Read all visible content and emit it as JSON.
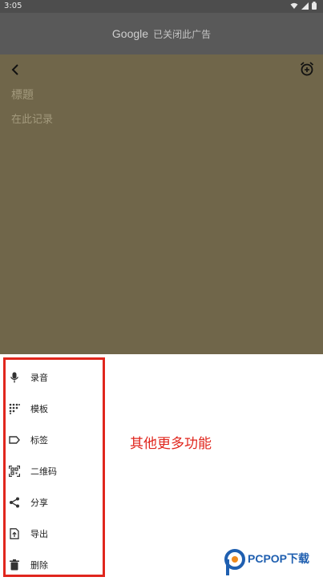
{
  "status_bar": {
    "time": "3:05",
    "icons": [
      "wifi-icon",
      "signal-icon",
      "battery-icon"
    ]
  },
  "ad_banner": {
    "brand": "Google",
    "text": "已关闭此广告"
  },
  "note": {
    "title_placeholder": "標題",
    "body_placeholder": "在此记录"
  },
  "menu": {
    "items": [
      {
        "label": "录音",
        "icon": "microphone-icon"
      },
      {
        "label": "模板",
        "icon": "template-icon"
      },
      {
        "label": "标签",
        "icon": "label-icon"
      },
      {
        "label": "二维码",
        "icon": "qr-code-icon"
      },
      {
        "label": "分享",
        "icon": "share-icon"
      },
      {
        "label": "导出",
        "icon": "export-icon"
      },
      {
        "label": "删除",
        "icon": "delete-icon"
      }
    ]
  },
  "annotation": {
    "text": "其他更多功能"
  },
  "watermark": {
    "brand": "PCPOP下载"
  },
  "colors": {
    "note_bg": "#70664a",
    "highlight": "#e0261d",
    "ad_bg": "#595959"
  }
}
